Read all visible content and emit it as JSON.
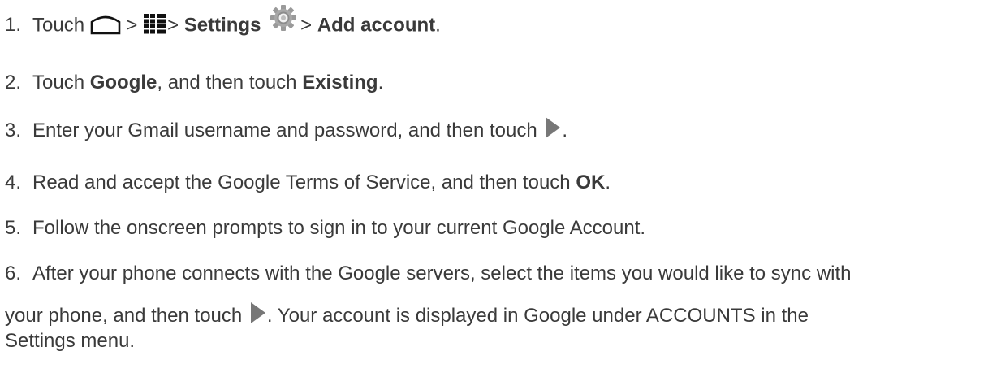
{
  "steps": [
    {
      "num": "1.",
      "t1": "Touch",
      "t2": ">",
      "t3": "> ",
      "b1": "Settings",
      "t4": "> ",
      "b2": "Add account",
      "t5": ".",
      "icons": [
        "home-icon",
        "apps-grid-icon",
        "settings-gear-icon"
      ]
    },
    {
      "num": "2.",
      "t1": "Touch ",
      "b1": "Google",
      "t2": ", and then touch ",
      "b2": "Existing",
      "t3": "."
    },
    {
      "num": "3.",
      "t1": "Enter your Gmail username and password, and then touch",
      "t2": ".",
      "icons": [
        "next-arrow-icon"
      ]
    },
    {
      "num": "4.",
      "t1": "Read and accept the Google Terms of Service, and then touch ",
      "b1": "OK",
      "t2": "."
    },
    {
      "num": "5.",
      "t1": "Follow the onscreen prompts to sign in to your current Google Account."
    },
    {
      "num": "6.",
      "line1": "After your phone connects with the Google servers, select the items you would like to sync with",
      "line2a": "your phone, and then touch",
      "line2b": ". Your account is displayed in Google under ACCOUNTS in the",
      "line3": "Settings menu.",
      "icons": [
        "next-arrow-icon"
      ]
    }
  ],
  "colors": {
    "text": "#3a3a3a",
    "icon_gray": "#777777"
  }
}
